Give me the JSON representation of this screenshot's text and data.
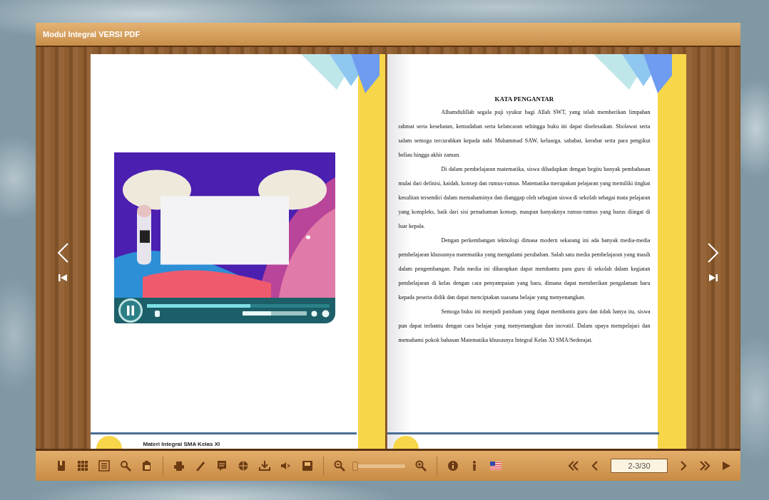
{
  "window": {
    "title": "Modul Integral VERSI PDF"
  },
  "left_page": {
    "video": {
      "playing": true,
      "progress": {
        "level": 0.57
      },
      "volume": {
        "level": 0.45
      }
    },
    "footer": "Materi Integral SMA Kelas XI"
  },
  "right_page": {
    "heading": "KATA PENGANTAR",
    "paragraphs": [
      "Alhamdulillah segala puji syukur bagi Allah SWT, yang telah memberikan limpahan rahmat serta kesehatan, kemudahan serta kelancaran sehingga buku ini dapat diselesaikan. Sholawat serta salam semoga tercurahkan kepada nabi Muhammad SAW, keluarga, sahabat, kerabat serta para pengikut beliau hingga akhir zaman.",
      "Di dalam pembelajaran matematika, siswa dihadapkan dengan begitu banyak pembahasan mulai dari definisi, kaidah, konsep dan rumus-rumus. Matematika merupakan pelajaran yang memiliki tingkat kesulitan tersendiri dalam memahaminya dan dianggap oleh sebagian siswa di sekolah sebagai mata pelajaran yang kompleks, baik dari sisi pemahaman konsep, maupun banyaknya rumus-rumus yang harus diingat di luar kepala.",
      "Dengan perkembangan teknologi dimasa modern sekarang ini ada banyak media-media pembelajaran khususnya matematika yang mengalami perubahan. Salah satu media pembelajaran yang masih dalam pengembangan. Pada media ini diharapkan dapat membantu para guru di sekolah dalam kegiatan pembelajaran di kelas dengan cara penyampaian yang baru, dimana dapat memberikan pengalaman baru kepada peserta didik dan dapat menciptakan suasana belajar yang menyenangkan.",
      "Semoga buku ini menjadi panduan yang dapat membantu guru dan tidak hanya itu, siswa pun dapat terbantu dengan cara belajar yang menyenangkan dan inovatif. Dalam upaya mempelajari dan memahami pokok bahasan Matematika khususnya Integral Kelas XI SMA/Sederajat."
    ]
  },
  "toolbar": {
    "zoom": {
      "level": 0.0
    },
    "page_field": "2-3/30"
  }
}
